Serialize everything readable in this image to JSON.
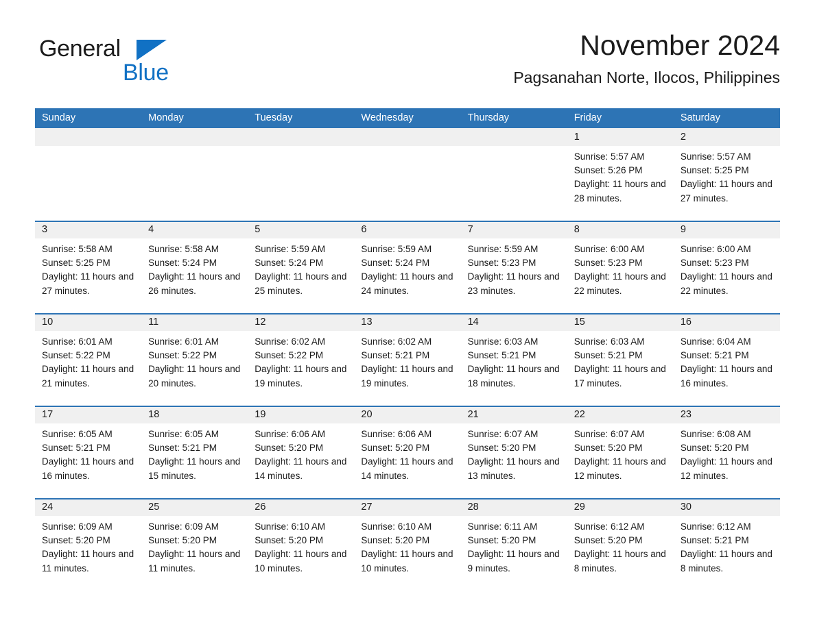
{
  "brand": {
    "name_part1": "General",
    "name_part2": "Blue",
    "triangle_icon": "brand-triangle-icon",
    "colors": {
      "blue": "#1171c4",
      "black": "#1b1b1b"
    }
  },
  "header": {
    "title": "November 2024",
    "subtitle": "Pagsanahan Norte, Ilocos, Philippines"
  },
  "theme": {
    "header_blue": "#2d74b5",
    "day_band_gray": "#f0f0f0",
    "separator_blue": "#2d74b5",
    "text": "#1b1b1b",
    "header_text": "#ffffff"
  },
  "weekdays": [
    {
      "label": "Sunday"
    },
    {
      "label": "Monday"
    },
    {
      "label": "Tuesday"
    },
    {
      "label": "Wednesday"
    },
    {
      "label": "Thursday"
    },
    {
      "label": "Friday"
    },
    {
      "label": "Saturday"
    }
  ],
  "weeks": [
    {
      "days": [
        {
          "num": "",
          "empty": true,
          "sunrise": "",
          "sunset": "",
          "daylight": ""
        },
        {
          "num": "",
          "empty": true,
          "sunrise": "",
          "sunset": "",
          "daylight": ""
        },
        {
          "num": "",
          "empty": true,
          "sunrise": "",
          "sunset": "",
          "daylight": ""
        },
        {
          "num": "",
          "empty": true,
          "sunrise": "",
          "sunset": "",
          "daylight": ""
        },
        {
          "num": "",
          "empty": true,
          "sunrise": "",
          "sunset": "",
          "daylight": ""
        },
        {
          "num": "1",
          "empty": false,
          "sunrise": "Sunrise: 5:57 AM",
          "sunset": "Sunset: 5:26 PM",
          "daylight": "Daylight: 11 hours and 28 minutes."
        },
        {
          "num": "2",
          "empty": false,
          "sunrise": "Sunrise: 5:57 AM",
          "sunset": "Sunset: 5:25 PM",
          "daylight": "Daylight: 11 hours and 27 minutes."
        }
      ]
    },
    {
      "days": [
        {
          "num": "3",
          "empty": false,
          "sunrise": "Sunrise: 5:58 AM",
          "sunset": "Sunset: 5:25 PM",
          "daylight": "Daylight: 11 hours and 27 minutes."
        },
        {
          "num": "4",
          "empty": false,
          "sunrise": "Sunrise: 5:58 AM",
          "sunset": "Sunset: 5:24 PM",
          "daylight": "Daylight: 11 hours and 26 minutes."
        },
        {
          "num": "5",
          "empty": false,
          "sunrise": "Sunrise: 5:59 AM",
          "sunset": "Sunset: 5:24 PM",
          "daylight": "Daylight: 11 hours and 25 minutes."
        },
        {
          "num": "6",
          "empty": false,
          "sunrise": "Sunrise: 5:59 AM",
          "sunset": "Sunset: 5:24 PM",
          "daylight": "Daylight: 11 hours and 24 minutes."
        },
        {
          "num": "7",
          "empty": false,
          "sunrise": "Sunrise: 5:59 AM",
          "sunset": "Sunset: 5:23 PM",
          "daylight": "Daylight: 11 hours and 23 minutes."
        },
        {
          "num": "8",
          "empty": false,
          "sunrise": "Sunrise: 6:00 AM",
          "sunset": "Sunset: 5:23 PM",
          "daylight": "Daylight: 11 hours and 22 minutes."
        },
        {
          "num": "9",
          "empty": false,
          "sunrise": "Sunrise: 6:00 AM",
          "sunset": "Sunset: 5:23 PM",
          "daylight": "Daylight: 11 hours and 22 minutes."
        }
      ]
    },
    {
      "days": [
        {
          "num": "10",
          "empty": false,
          "sunrise": "Sunrise: 6:01 AM",
          "sunset": "Sunset: 5:22 PM",
          "daylight": "Daylight: 11 hours and 21 minutes."
        },
        {
          "num": "11",
          "empty": false,
          "sunrise": "Sunrise: 6:01 AM",
          "sunset": "Sunset: 5:22 PM",
          "daylight": "Daylight: 11 hours and 20 minutes."
        },
        {
          "num": "12",
          "empty": false,
          "sunrise": "Sunrise: 6:02 AM",
          "sunset": "Sunset: 5:22 PM",
          "daylight": "Daylight: 11 hours and 19 minutes."
        },
        {
          "num": "13",
          "empty": false,
          "sunrise": "Sunrise: 6:02 AM",
          "sunset": "Sunset: 5:21 PM",
          "daylight": "Daylight: 11 hours and 19 minutes."
        },
        {
          "num": "14",
          "empty": false,
          "sunrise": "Sunrise: 6:03 AM",
          "sunset": "Sunset: 5:21 PM",
          "daylight": "Daylight: 11 hours and 18 minutes."
        },
        {
          "num": "15",
          "empty": false,
          "sunrise": "Sunrise: 6:03 AM",
          "sunset": "Sunset: 5:21 PM",
          "daylight": "Daylight: 11 hours and 17 minutes."
        },
        {
          "num": "16",
          "empty": false,
          "sunrise": "Sunrise: 6:04 AM",
          "sunset": "Sunset: 5:21 PM",
          "daylight": "Daylight: 11 hours and 16 minutes."
        }
      ]
    },
    {
      "days": [
        {
          "num": "17",
          "empty": false,
          "sunrise": "Sunrise: 6:05 AM",
          "sunset": "Sunset: 5:21 PM",
          "daylight": "Daylight: 11 hours and 16 minutes."
        },
        {
          "num": "18",
          "empty": false,
          "sunrise": "Sunrise: 6:05 AM",
          "sunset": "Sunset: 5:21 PM",
          "daylight": "Daylight: 11 hours and 15 minutes."
        },
        {
          "num": "19",
          "empty": false,
          "sunrise": "Sunrise: 6:06 AM",
          "sunset": "Sunset: 5:20 PM",
          "daylight": "Daylight: 11 hours and 14 minutes."
        },
        {
          "num": "20",
          "empty": false,
          "sunrise": "Sunrise: 6:06 AM",
          "sunset": "Sunset: 5:20 PM",
          "daylight": "Daylight: 11 hours and 14 minutes."
        },
        {
          "num": "21",
          "empty": false,
          "sunrise": "Sunrise: 6:07 AM",
          "sunset": "Sunset: 5:20 PM",
          "daylight": "Daylight: 11 hours and 13 minutes."
        },
        {
          "num": "22",
          "empty": false,
          "sunrise": "Sunrise: 6:07 AM",
          "sunset": "Sunset: 5:20 PM",
          "daylight": "Daylight: 11 hours and 12 minutes."
        },
        {
          "num": "23",
          "empty": false,
          "sunrise": "Sunrise: 6:08 AM",
          "sunset": "Sunset: 5:20 PM",
          "daylight": "Daylight: 11 hours and 12 minutes."
        }
      ]
    },
    {
      "days": [
        {
          "num": "24",
          "empty": false,
          "sunrise": "Sunrise: 6:09 AM",
          "sunset": "Sunset: 5:20 PM",
          "daylight": "Daylight: 11 hours and 11 minutes."
        },
        {
          "num": "25",
          "empty": false,
          "sunrise": "Sunrise: 6:09 AM",
          "sunset": "Sunset: 5:20 PM",
          "daylight": "Daylight: 11 hours and 11 minutes."
        },
        {
          "num": "26",
          "empty": false,
          "sunrise": "Sunrise: 6:10 AM",
          "sunset": "Sunset: 5:20 PM",
          "daylight": "Daylight: 11 hours and 10 minutes."
        },
        {
          "num": "27",
          "empty": false,
          "sunrise": "Sunrise: 6:10 AM",
          "sunset": "Sunset: 5:20 PM",
          "daylight": "Daylight: 11 hours and 10 minutes."
        },
        {
          "num": "28",
          "empty": false,
          "sunrise": "Sunrise: 6:11 AM",
          "sunset": "Sunset: 5:20 PM",
          "daylight": "Daylight: 11 hours and 9 minutes."
        },
        {
          "num": "29",
          "empty": false,
          "sunrise": "Sunrise: 6:12 AM",
          "sunset": "Sunset: 5:20 PM",
          "daylight": "Daylight: 11 hours and 8 minutes."
        },
        {
          "num": "30",
          "empty": false,
          "sunrise": "Sunrise: 6:12 AM",
          "sunset": "Sunset: 5:21 PM",
          "daylight": "Daylight: 11 hours and 8 minutes."
        }
      ]
    }
  ]
}
